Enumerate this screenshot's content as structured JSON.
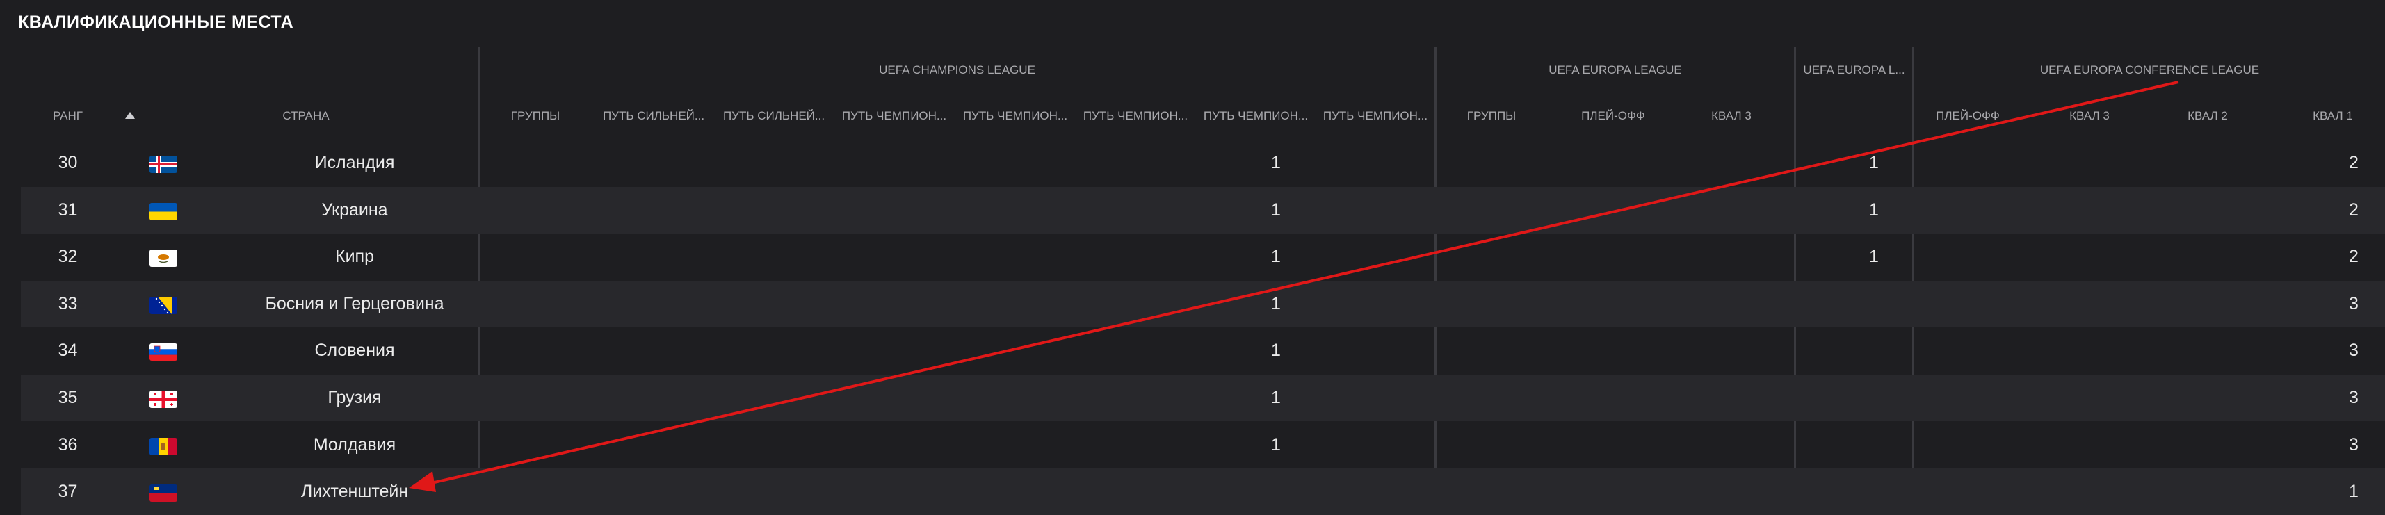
{
  "title": "КВАЛИФИКАЦИОННЫЕ МЕСТА",
  "groups": {
    "ucl": "UEFA CHAMPIONS LEAGUE",
    "uel": "UEFA EUROPA LEAGUE",
    "uel_short": "UEFA EUROPA L...",
    "uecl": "UEFA EUROPA CONFERENCE LEAGUE"
  },
  "headers": {
    "rank": "РАНГ",
    "country": "СТРАНА",
    "ucl_groups": "ГРУППЫ",
    "ucl_p1": "ПУТЬ СИЛЬНЕЙ...",
    "ucl_p2": "ПУТЬ СИЛЬНЕЙ...",
    "ucl_p3": "ПУТЬ ЧЕМПИОН...",
    "ucl_p4": "ПУТЬ ЧЕМПИОН...",
    "ucl_p5": "ПУТЬ ЧЕМПИОН...",
    "ucl_p6": "ПУТЬ ЧЕМПИОН...",
    "ucl_p7": "ПУТЬ ЧЕМПИОН...",
    "uel_groups": "ГРУППЫ",
    "uel_playoff": "ПЛЕЙ-ОФФ",
    "uel_q3": "КВАЛ 3",
    "uel_col4": "",
    "uecl_playoff": "ПЛЕЙ-ОФФ",
    "uecl_q3": "КВАЛ 3",
    "uecl_q2": "КВАЛ 2",
    "uecl_q1": "КВАЛ 1"
  },
  "rows": [
    {
      "rank": "30",
      "country": "Исландия",
      "flag": "iceland-flag",
      "ucl": "1",
      "uel": "1",
      "uecl_q1": "2"
    },
    {
      "rank": "31",
      "country": "Украина",
      "flag": "ukraine-flag",
      "ucl": "1",
      "uel": "1",
      "uecl_q1": "2"
    },
    {
      "rank": "32",
      "country": "Кипр",
      "flag": "cyprus-flag",
      "ucl": "1",
      "uel": "1",
      "uecl_q1": "2"
    },
    {
      "rank": "33",
      "country": "Босния и Герцеговина",
      "flag": "bosnia-flag",
      "ucl": "1",
      "uel": "",
      "uecl_q1": "3"
    },
    {
      "rank": "34",
      "country": "Словения",
      "flag": "slovenia-flag",
      "ucl": "1",
      "uel": "",
      "uecl_q1": "3"
    },
    {
      "rank": "35",
      "country": "Грузия",
      "flag": "georgia-flag",
      "ucl": "1",
      "uel": "",
      "uecl_q1": "3"
    },
    {
      "rank": "36",
      "country": "Молдавия",
      "flag": "moldova-flag",
      "ucl": "1",
      "uel": "",
      "uecl_q1": "3"
    },
    {
      "rank": "37",
      "country": "Лихтенштейн",
      "flag": "liechtenstein-flag",
      "ucl": "",
      "uel": "",
      "uecl_q1": "1"
    }
  ],
  "colors": {
    "background": "#1e1e21",
    "row_alt": "#28282c",
    "annotation_arrow": "#e01818"
  }
}
